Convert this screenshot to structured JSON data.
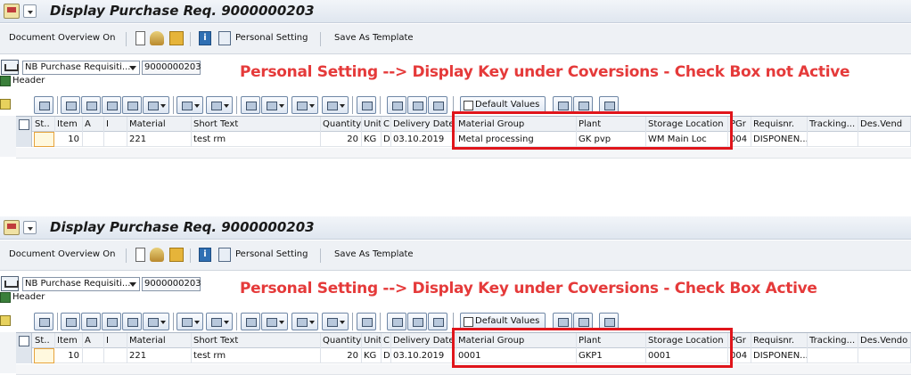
{
  "title": "Display Purchase Req. 9000000203",
  "appbar": {
    "doc_overview": "Document Overview On",
    "personal_setting": "Personal Setting",
    "save_template": "Save As Template"
  },
  "header": {
    "doc_type": "NB Purchase Requisiti...",
    "doc_number": "9000000203",
    "header_label": "Header"
  },
  "toolbar": {
    "default_values": "Default Values"
  },
  "columns": [
    "St..",
    "Item",
    "A",
    "I",
    "Material",
    "Short Text",
    "Quantity",
    "Unit",
    "C",
    "Delivery Date",
    "Material Group",
    "Plant",
    "Storage Location",
    "PGr",
    "Requisnr.",
    "Tracking...",
    "Des.Vend"
  ],
  "columns_bottom_last": "Des.Vendo",
  "panels": [
    {
      "annotation_text": "Personal Setting --> Display Key under Coversions -",
      "annotation_status": "Check Box not Active",
      "row": {
        "item": "10",
        "material": "221",
        "short_text": "test rm",
        "quantity": "20",
        "unit": "KG",
        "c": "D",
        "delivery_date": "03.10.2019",
        "material_group": "Metal processing",
        "plant": "GK pvp",
        "storage_location": "WM Main Loc",
        "pgr": "004",
        "requisnr": "DISPONEN..."
      }
    },
    {
      "annotation_text": "Personal Setting --> Display Key under Coversions -",
      "annotation_status": "Check Box Active",
      "row": {
        "item": "10",
        "material": "221",
        "short_text": "test rm",
        "quantity": "20",
        "unit": "KG",
        "c": "D",
        "delivery_date": "03.10.2019",
        "material_group": "0001",
        "plant": "GKP1",
        "storage_location": "0001",
        "pgr": "004",
        "requisnr": "DISPONEN..."
      }
    }
  ],
  "colors": {
    "annotation": "#e53a3a",
    "highlight_box": "#e0151b",
    "titlebar": "#dfe6ef"
  }
}
